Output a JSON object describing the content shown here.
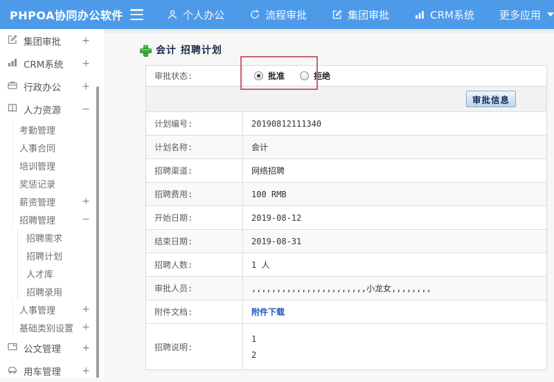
{
  "colors": {
    "topbar_blue": "#4d9be8",
    "plus_green": "#3fae3f",
    "annotation_red": "#c4636c",
    "link_blue": "#2358c0"
  },
  "topbar": {
    "logo": "PHPOA协同办公软件",
    "nav": [
      {
        "label": "个人办公",
        "icon": "person-icon"
      },
      {
        "label": "流程审批",
        "icon": "process-cycle-icon"
      },
      {
        "label": "集团审批",
        "icon": "edit-icon"
      },
      {
        "label": "CRM系统",
        "icon": "bar-chart-icon"
      },
      {
        "label": "更多应用",
        "icon": "caret-down-icon"
      }
    ]
  },
  "sidebar": {
    "items": [
      {
        "label": "集团审批",
        "icon": "edit-icon",
        "toggle": "+",
        "level": 1
      },
      {
        "label": "CRM系统",
        "icon": "bar-chart-icon",
        "toggle": "+",
        "level": 1
      },
      {
        "label": "行政办公",
        "icon": "briefcase-icon",
        "toggle": "+",
        "level": 1
      },
      {
        "label": "人力资源",
        "icon": "book-icon",
        "toggle": "−",
        "level": 1
      },
      {
        "label": "考勤管理",
        "toggle": "",
        "level": 2
      },
      {
        "label": "人事合同",
        "toggle": "",
        "level": 2
      },
      {
        "label": "培训管理",
        "toggle": "",
        "level": 2
      },
      {
        "label": "奖惩记录",
        "toggle": "",
        "level": 2
      },
      {
        "label": "薪资管理",
        "toggle": "+",
        "level": 2
      },
      {
        "label": "招聘管理",
        "toggle": "−",
        "level": 2
      },
      {
        "label": "招聘需求",
        "toggle": "",
        "level": 3
      },
      {
        "label": "招聘计划",
        "toggle": "",
        "level": 3
      },
      {
        "label": "人才库",
        "toggle": "",
        "level": 3
      },
      {
        "label": "招聘录用",
        "toggle": "",
        "level": 3
      },
      {
        "label": "人事管理",
        "toggle": "+",
        "level": 2
      },
      {
        "label": "基础类别设置",
        "toggle": "+",
        "level": 2
      },
      {
        "label": "公文管理",
        "icon": "document-icon",
        "toggle": "+",
        "level": 1
      },
      {
        "label": "用车管理",
        "icon": "car-icon",
        "toggle": "+",
        "level": 1
      }
    ]
  },
  "main": {
    "title": "会计 招聘计划",
    "approval": {
      "label": "审批状态:",
      "options": [
        {
          "label": "批准",
          "selected": true
        },
        {
          "label": "拒绝",
          "selected": false
        }
      ]
    },
    "toolbar": {
      "button_label": "审批信息"
    },
    "fields": [
      {
        "label": "计划编号:",
        "value": "20190812111340"
      },
      {
        "label": "计划名称:",
        "value": "会计"
      },
      {
        "label": "招聘渠道:",
        "value": "网络招聘"
      },
      {
        "label": "招聘费用:",
        "value": "100 RMB"
      },
      {
        "label": "开始日期:",
        "value": "2019-08-12"
      },
      {
        "label": "结束日期:",
        "value": "2019-08-31"
      },
      {
        "label": "招聘人数:",
        "value": "1 人"
      },
      {
        "label": "审批人员:",
        "value": ",,,,,,,,,,,,,,,,,,,,,,,小龙女,,,,,,,,"
      },
      {
        "label": "附件文档:",
        "value": "附件下载"
      },
      {
        "label": "招聘说明:",
        "lines": [
          "1",
          "2"
        ]
      }
    ]
  }
}
